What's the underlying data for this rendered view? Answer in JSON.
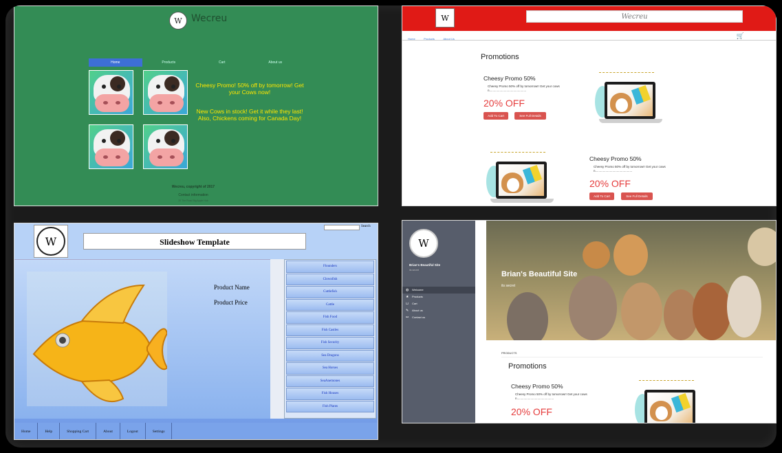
{
  "panel1": {
    "logo": "W",
    "brand": "Wecreu",
    "nav": [
      "Home",
      "Products",
      "Cart",
      "About us"
    ],
    "promo1": "Cheesy Promo! 50% off by tomorrow! Get your Cows now!",
    "promo2": "New Cows in stock! Get it while they last! Also, Chickens coming for Canada Day!",
    "footer": "Wecreu, copyright of 2017",
    "footer_link": "Contact information",
    "footer_small": "20 The Road Big Apple Hub"
  },
  "panel2": {
    "logo": "W",
    "title": "Wecreu",
    "nav": [
      "Home",
      "Products",
      "About Us"
    ],
    "cart_icon": "cart-icon",
    "section_title": "Promotions",
    "card1": {
      "title": "Cheesy Promo 50%",
      "text": "Cheesy Promo 50% off by tomorrow!! Get your cows n...........................................",
      "off": "20% OFF",
      "btn_add": "Add To Cart",
      "btn_details": "See Full Details"
    },
    "card2": {
      "title": "Cheesy Promo 50%",
      "text": "Cheesy Promo 50% off by tomorrow!! Get your cows n...........................................",
      "off": "20% OFF",
      "btn_add": "Add To Cart",
      "btn_details": "See Full Details"
    },
    "accent": "#e01a16"
  },
  "panel3": {
    "logo": "W",
    "title": "Slideshow Template",
    "search_label": "Search",
    "product_name": "Product Name",
    "product_price": "Product Price",
    "list": [
      "Flounders",
      "Clownfish",
      "Cuttlefish",
      "Cattle",
      "Fish Food",
      "Fish Castles",
      "Fish Security",
      "Sea Dragons",
      "Sea Horses",
      "SeaAnemones",
      "Fish Houses",
      "Fish Plants"
    ],
    "bottom_nav": [
      "Home",
      "Help",
      "Shopping Cart",
      "About",
      "Logout",
      "Settings"
    ]
  },
  "panel4": {
    "logo": "W",
    "site_name": "Brian's Beautiful Site",
    "site_sub": "its secret",
    "menu": [
      {
        "icon": "globe-icon",
        "glyph": "◍",
        "label": "Welcome"
      },
      {
        "icon": "star-icon",
        "glyph": "★",
        "label": "Products"
      },
      {
        "icon": "cart-icon",
        "glyph": "⊔",
        "label": "Cart"
      },
      {
        "icon": "pencil-icon",
        "glyph": "✎",
        "label": "About us"
      },
      {
        "icon": "link-icon",
        "glyph": "⚯",
        "label": "Contact us"
      }
    ],
    "hero_title": "Brian's Beautiful Site",
    "hero_sub": "its secret",
    "products_label": "PRODUCTS",
    "section_title": "Promotions",
    "card_title": "Cheesy Promo 50%",
    "card_text": "Cheesy Promo 50% off by tomorrow!! Get your cows n...........................................",
    "card_off": "20% OFF"
  }
}
